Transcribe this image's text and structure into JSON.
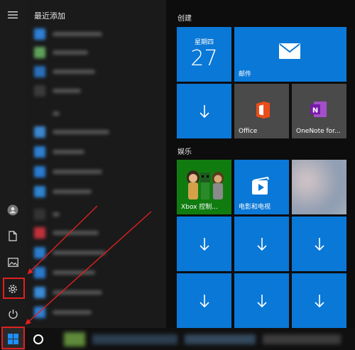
{
  "recent_section": {
    "title": "最近添加"
  },
  "groups": {
    "create": "创建",
    "entertainment": "娱乐"
  },
  "tiles": {
    "calendar": {
      "day": "星期四",
      "date": "27"
    },
    "mail": {
      "label": "邮件"
    },
    "office": {
      "label": "Office"
    },
    "onenote": {
      "label": "OneNote for..."
    },
    "xbox": {
      "label": "Xbox 控制..."
    },
    "movies": {
      "label": "电影和电视"
    }
  },
  "rail": {
    "icons": [
      "hamburger-menu-icon",
      "user-icon",
      "document-icon",
      "pictures-icon",
      "settings-icon",
      "power-icon"
    ]
  },
  "taskbar": {
    "icons": [
      "windows-start-icon",
      "cortana-circle-icon"
    ]
  },
  "colors": {
    "tile_blue": "#0a78d7",
    "annotation_red": "#e02020",
    "xbox_green": "#107c10"
  }
}
